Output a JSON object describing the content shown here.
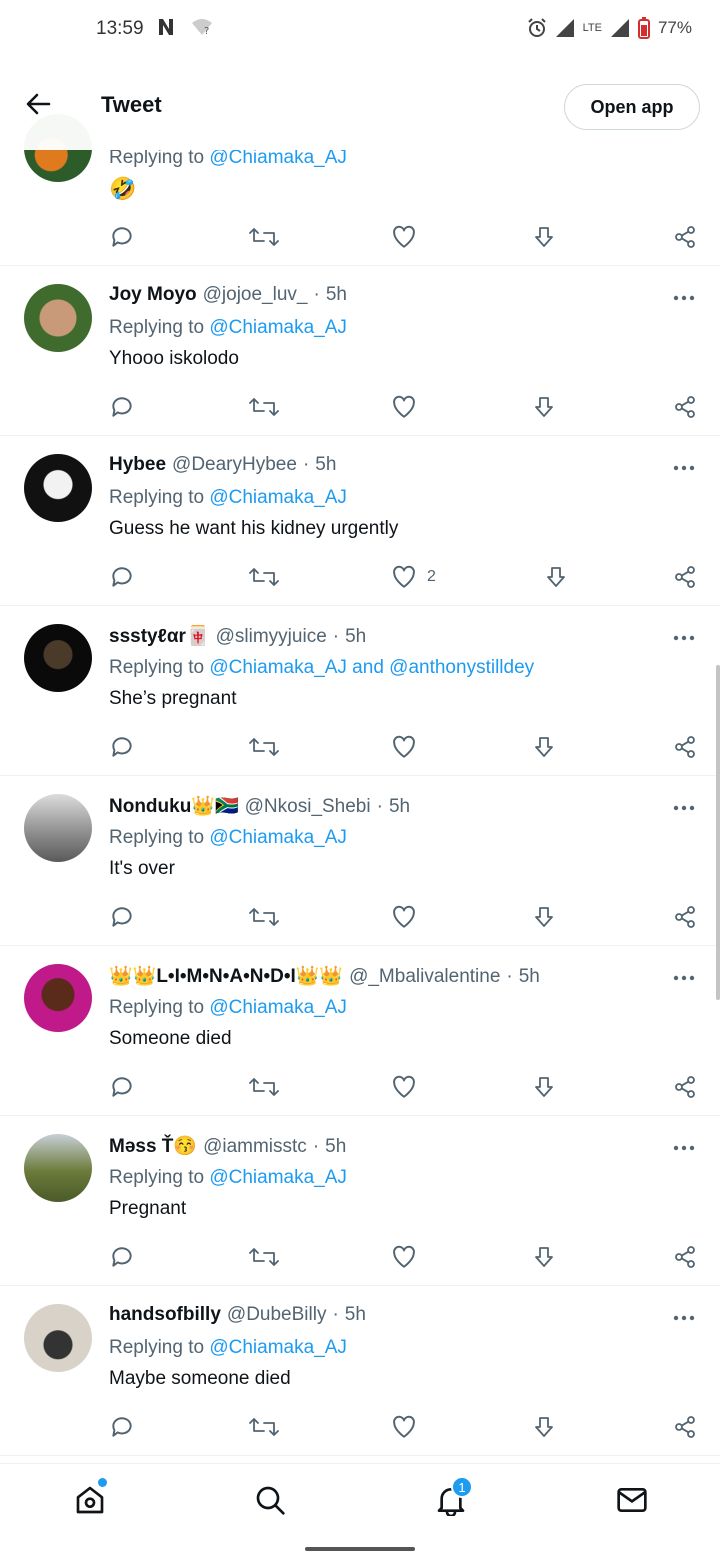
{
  "status_bar": {
    "time": "13:59",
    "battery": "77%",
    "network": "LTE"
  },
  "header": {
    "title": "Tweet",
    "open_app_label": "Open app"
  },
  "replying_prefix": "Replying to",
  "top_partial": {
    "reply_to": "@Chiamaka_AJ",
    "text": "🤣"
  },
  "tweets": [
    {
      "name": "Joy Moyo",
      "handle": "@jojoe_luv_",
      "time": "5h",
      "reply_to": "@Chiamaka_AJ",
      "text": "Yhooo iskolodo",
      "likes": ""
    },
    {
      "name": "Hybee",
      "handle": "@DearyHybee",
      "time": "5h",
      "reply_to": "@Chiamaka_AJ",
      "text": "Guess he want his kidney urgently",
      "likes": "2"
    },
    {
      "name": "ssstyℓαr🀄",
      "handle": "@slimyyjuice",
      "time": "5h",
      "reply_to": "@Chiamaka_AJ and @anthonystilldey",
      "text": "She’s pregnant",
      "likes": ""
    },
    {
      "name": "Nonduku👑🇿🇦",
      "handle": "@Nkosi_Shebi",
      "time": "5h",
      "reply_to": "@Chiamaka_AJ",
      "text": "It's over",
      "likes": ""
    },
    {
      "name": "👑👑L•I•M•N•A•N•D•I👑👑",
      "handle": "@_Mbalivalentine",
      "time": "5h",
      "reply_to": "@Chiamaka_AJ",
      "text": "Someone died",
      "likes": ""
    },
    {
      "name": "Mǝss Ť😚",
      "handle": "@iammisstc",
      "time": "5h",
      "reply_to": "@Chiamaka_AJ",
      "text": "Pregnant",
      "likes": ""
    },
    {
      "name": "handsofbilly",
      "handle": "@DubeBilly",
      "time": "5h",
      "reply_to": "@Chiamaka_AJ",
      "text": "Maybe someone died",
      "likes": ""
    }
  ],
  "bottom_nav": {
    "notifications_badge": "1"
  },
  "colors": {
    "accent": "#1d9bf0",
    "secondary_text": "#536471",
    "divider": "#eff3f4"
  },
  "icons": [
    "back-arrow-icon",
    "reply-icon",
    "retweet-icon",
    "like-icon",
    "bookmark-download-icon",
    "share-icon",
    "more-icon",
    "home-icon",
    "search-icon",
    "bell-icon",
    "mail-icon"
  ]
}
